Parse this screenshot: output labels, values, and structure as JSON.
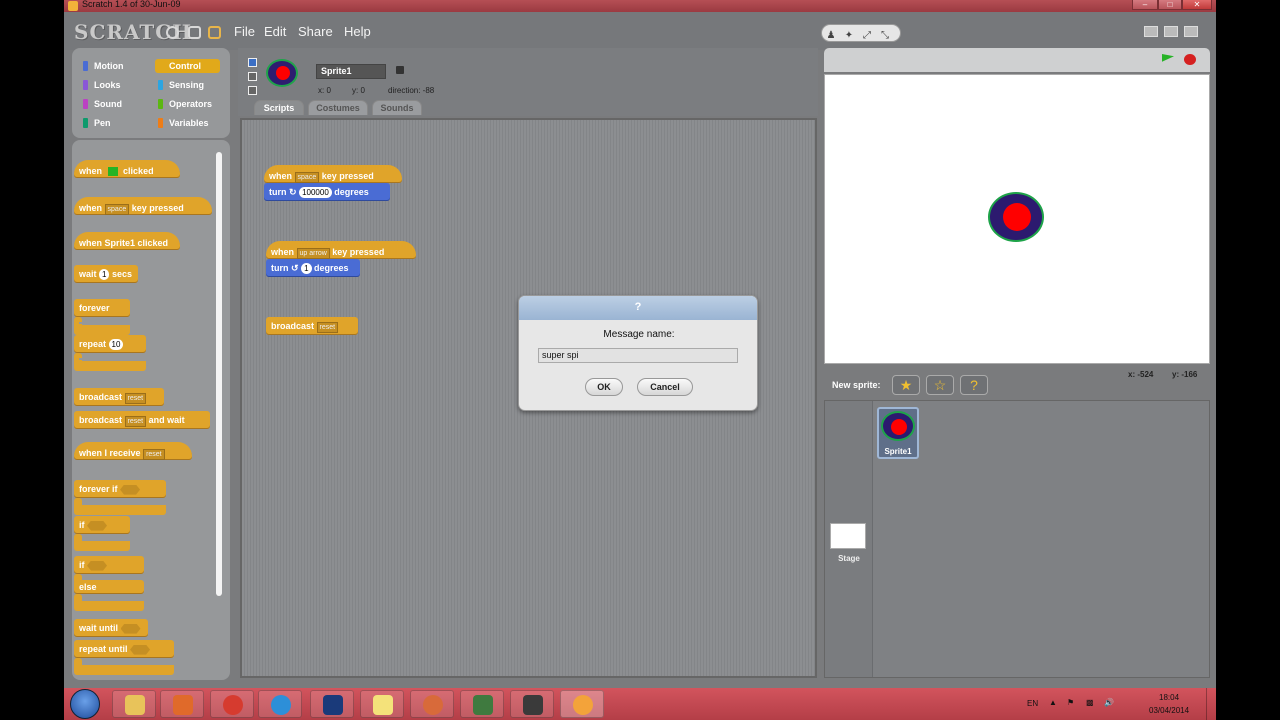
{
  "window": {
    "title": "Scratch 1.4 of 30-Jun-09"
  },
  "menubar": {
    "logo": "SCRATCH",
    "menus": [
      "File",
      "Edit",
      "Share",
      "Help"
    ]
  },
  "categories": [
    {
      "label": "Motion",
      "color": "#4a6cd4"
    },
    {
      "label": "Control",
      "color": "#e1a91a",
      "selected": true
    },
    {
      "label": "Looks",
      "color": "#8a55d7"
    },
    {
      "label": "Sensing",
      "color": "#2ca5e2"
    },
    {
      "label": "Sound",
      "color": "#bb42c3"
    },
    {
      "label": "Operators",
      "color": "#5cb712"
    },
    {
      "label": "Pen",
      "color": "#0e9a6c"
    },
    {
      "label": "Variables",
      "color": "#ee7d16"
    }
  ],
  "palette": {
    "when_flag_a": "when",
    "when_flag_b": "clicked",
    "when_key_a": "when",
    "when_key_dd": "space",
    "when_key_b": "key pressed",
    "when_sprite": "when Sprite1 clicked",
    "wait_a": "wait",
    "wait_val": "1",
    "wait_b": "secs",
    "forever": "forever",
    "repeat": "repeat",
    "repeat_val": "10",
    "broadcast": "broadcast",
    "broadcast_dd": "reset",
    "broadcast_wait": "broadcast",
    "broadcast_wait_dd": "reset",
    "broadcast_wait_b": "and wait",
    "when_receive": "when I receive",
    "when_receive_dd": "reset",
    "forever_if": "forever if",
    "if1": "if",
    "if2": "if",
    "else": "else",
    "wait_until": "wait until",
    "repeat_until": "repeat until"
  },
  "sprite": {
    "name": "Sprite1",
    "x_label": "x: 0",
    "y_label": "y: 0",
    "direction_label": "direction: -88"
  },
  "tabs": [
    "Scripts",
    "Costumes",
    "Sounds"
  ],
  "scripts": {
    "s1_when": "when",
    "s1_dd": "space",
    "s1_key": "key pressed",
    "s1_turn": "turn",
    "s1_val": "100000",
    "s1_deg": "degrees",
    "s2_when": "when",
    "s2_dd": "up arrow",
    "s2_key": "key pressed",
    "s2_turn": "turn",
    "s2_val": "1",
    "s2_deg": "degrees",
    "s3_broadcast": "broadcast",
    "s3_dd": "reset"
  },
  "dialog": {
    "title": "?",
    "label": "Message name:",
    "input_value": "super spi",
    "ok": "OK",
    "cancel": "Cancel"
  },
  "stage": {
    "mouse_x": "x: -524",
    "mouse_y": "y: -166"
  },
  "sprite_list": {
    "new_sprite_label": "New sprite:",
    "sprite_name": "Sprite1",
    "stage_label": "Stage"
  },
  "taskbar": {
    "lang": "EN",
    "time": "18:04",
    "date": "03/04/2014"
  }
}
